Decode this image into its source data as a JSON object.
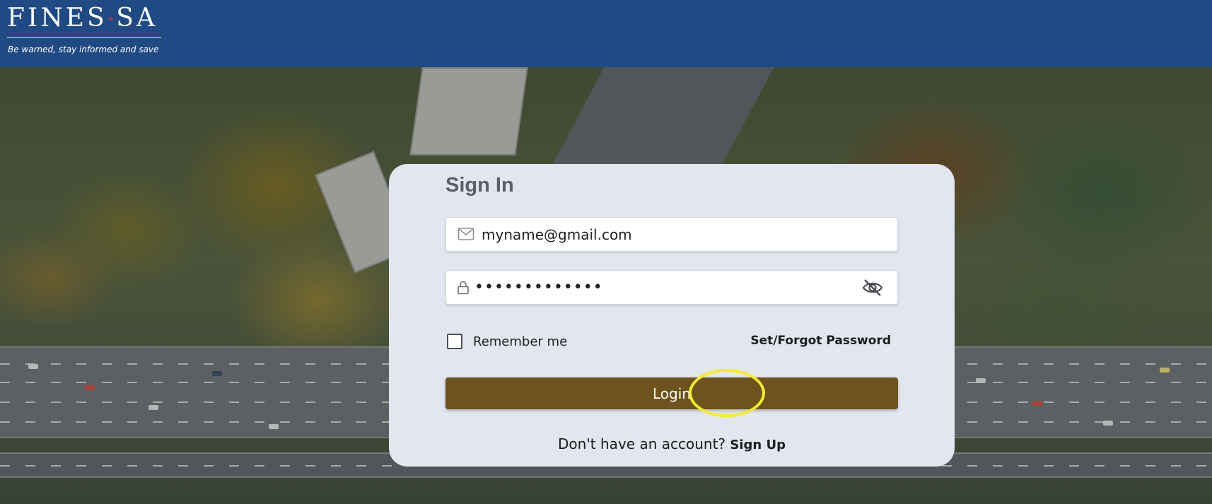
{
  "header": {
    "logo": {
      "title_left": "FINES",
      "title_dot": "•",
      "title_right": "SA",
      "tagline": "Be warned, stay informed and save"
    },
    "background_color": "#1f4a84"
  },
  "signin": {
    "title": "Sign In",
    "email": {
      "value": "myname@gmail.com",
      "icon": "envelope-icon"
    },
    "password": {
      "masked_value": "•••••••••••••",
      "icon": "lock-icon",
      "toggle_icon": "eye-slash-icon"
    },
    "remember_me": {
      "label": "Remember me",
      "checked": false
    },
    "forgot_password_label": "Set/Forgot Password",
    "login_label": "Login",
    "signup_prompt": "Don't have an account?",
    "signup_link": "Sign Up"
  },
  "colors": {
    "card_background": "#e1e6ef",
    "login_button": "#6e531e",
    "highlight_ring": "#f7ec1f"
  }
}
